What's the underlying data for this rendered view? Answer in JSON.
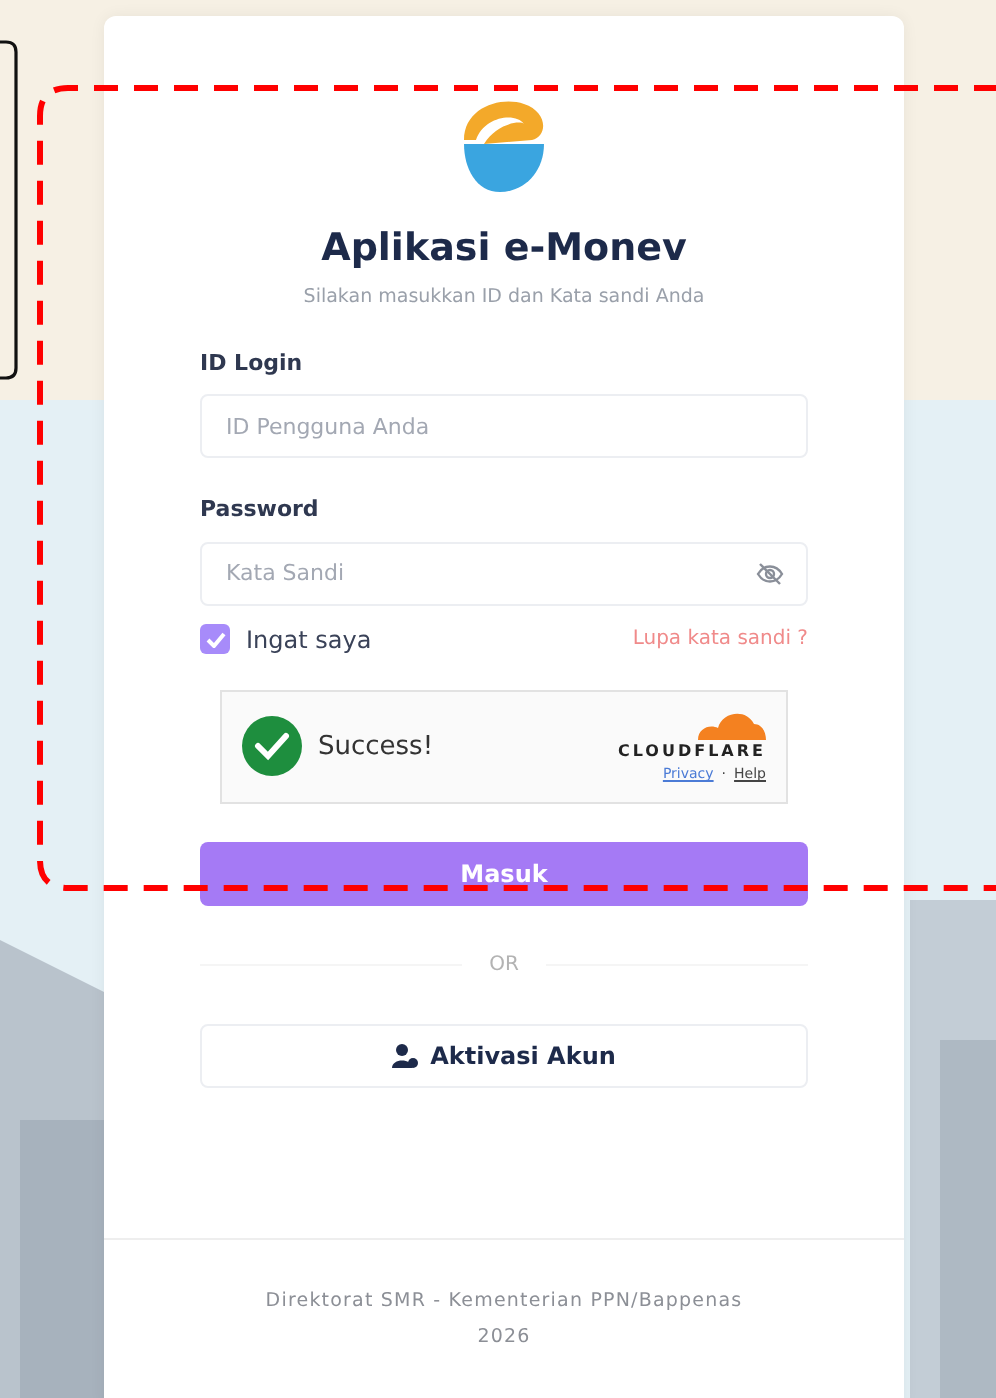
{
  "app": {
    "title": "Aplikasi e-Monev",
    "subtitle": "Silakan masukkan ID dan Kata sandi Anda"
  },
  "fields": [
    {
      "label": "ID Login",
      "placeholder": "ID Pengguna Anda",
      "kind": "text"
    },
    {
      "label": "Password",
      "placeholder": "Kata Sandi",
      "kind": "password"
    }
  ],
  "remember": {
    "label": "Ingat saya",
    "checked": true
  },
  "forgot_link": "Lupa kata sandi ?",
  "captcha": {
    "status": "Success!",
    "brand": "CLOUDFLARE",
    "links": [
      "Privacy",
      "Help"
    ],
    "separator": "·"
  },
  "login_button": "Masuk",
  "divider": "OR",
  "activate_button": "Aktivasi Akun",
  "footer": [
    "Direktorat SMR - Kementerian PPN/Bappenas",
    "2026"
  ]
}
